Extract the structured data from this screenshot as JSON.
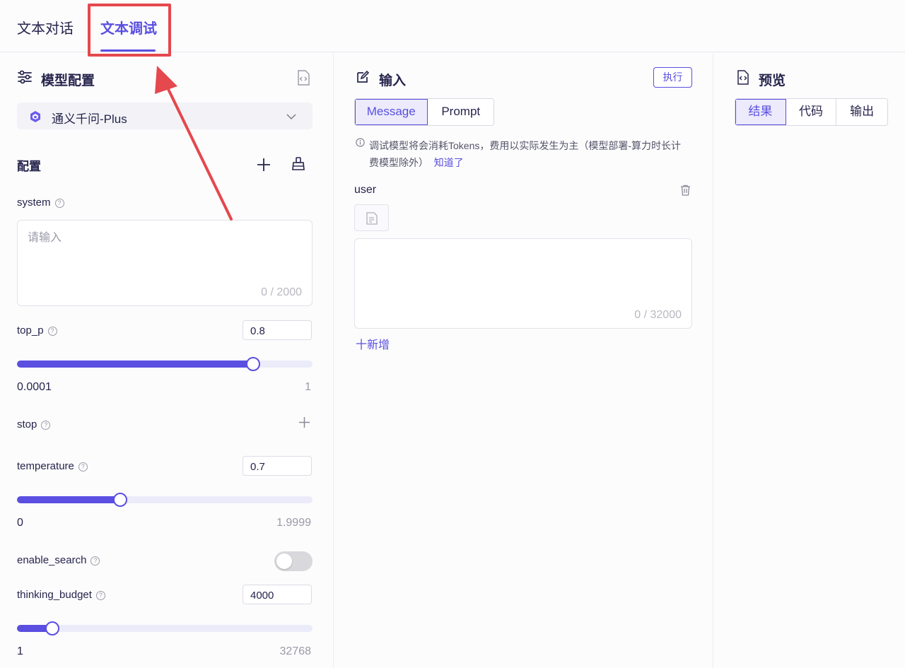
{
  "tabs": [
    {
      "label": "文本对话"
    },
    {
      "label": "文本调试"
    }
  ],
  "left": {
    "title": "模型配置",
    "model": {
      "name": "通义千问-Plus"
    },
    "config_label": "配置",
    "system": {
      "label": "system",
      "placeholder": "请输入",
      "counter": "0 / 2000"
    },
    "top_p": {
      "label": "top_p",
      "value": "0.8",
      "min": "0.0001",
      "max": "1",
      "fraction": 0.8
    },
    "stop": {
      "label": "stop"
    },
    "temperature": {
      "label": "temperature",
      "value": "0.7",
      "min": "0",
      "max": "1.9999",
      "fraction": 0.35
    },
    "enable_search": {
      "label": "enable_search",
      "on": false
    },
    "thinking_budget": {
      "label": "thinking_budget",
      "value": "4000",
      "min": "1",
      "max": "32768",
      "fraction": 0.12
    }
  },
  "mid": {
    "title": "输入",
    "run_label": "执行",
    "modes": [
      "Message",
      "Prompt"
    ],
    "active_mode": "Message",
    "notice": "调试模型将会消耗Tokens，费用以实际发生为主（模型部署-算力时长计费模型除外）",
    "notice_link": "知道了",
    "role": "user",
    "counter": "0 / 32000",
    "add_label": "十新增"
  },
  "right": {
    "title": "预览",
    "views": [
      "结果",
      "代码",
      "输出"
    ],
    "active_view": "结果"
  },
  "colors": {
    "accent": "#5a4fe0",
    "annotation": "#e5484d",
    "track": "#ecebfa"
  }
}
